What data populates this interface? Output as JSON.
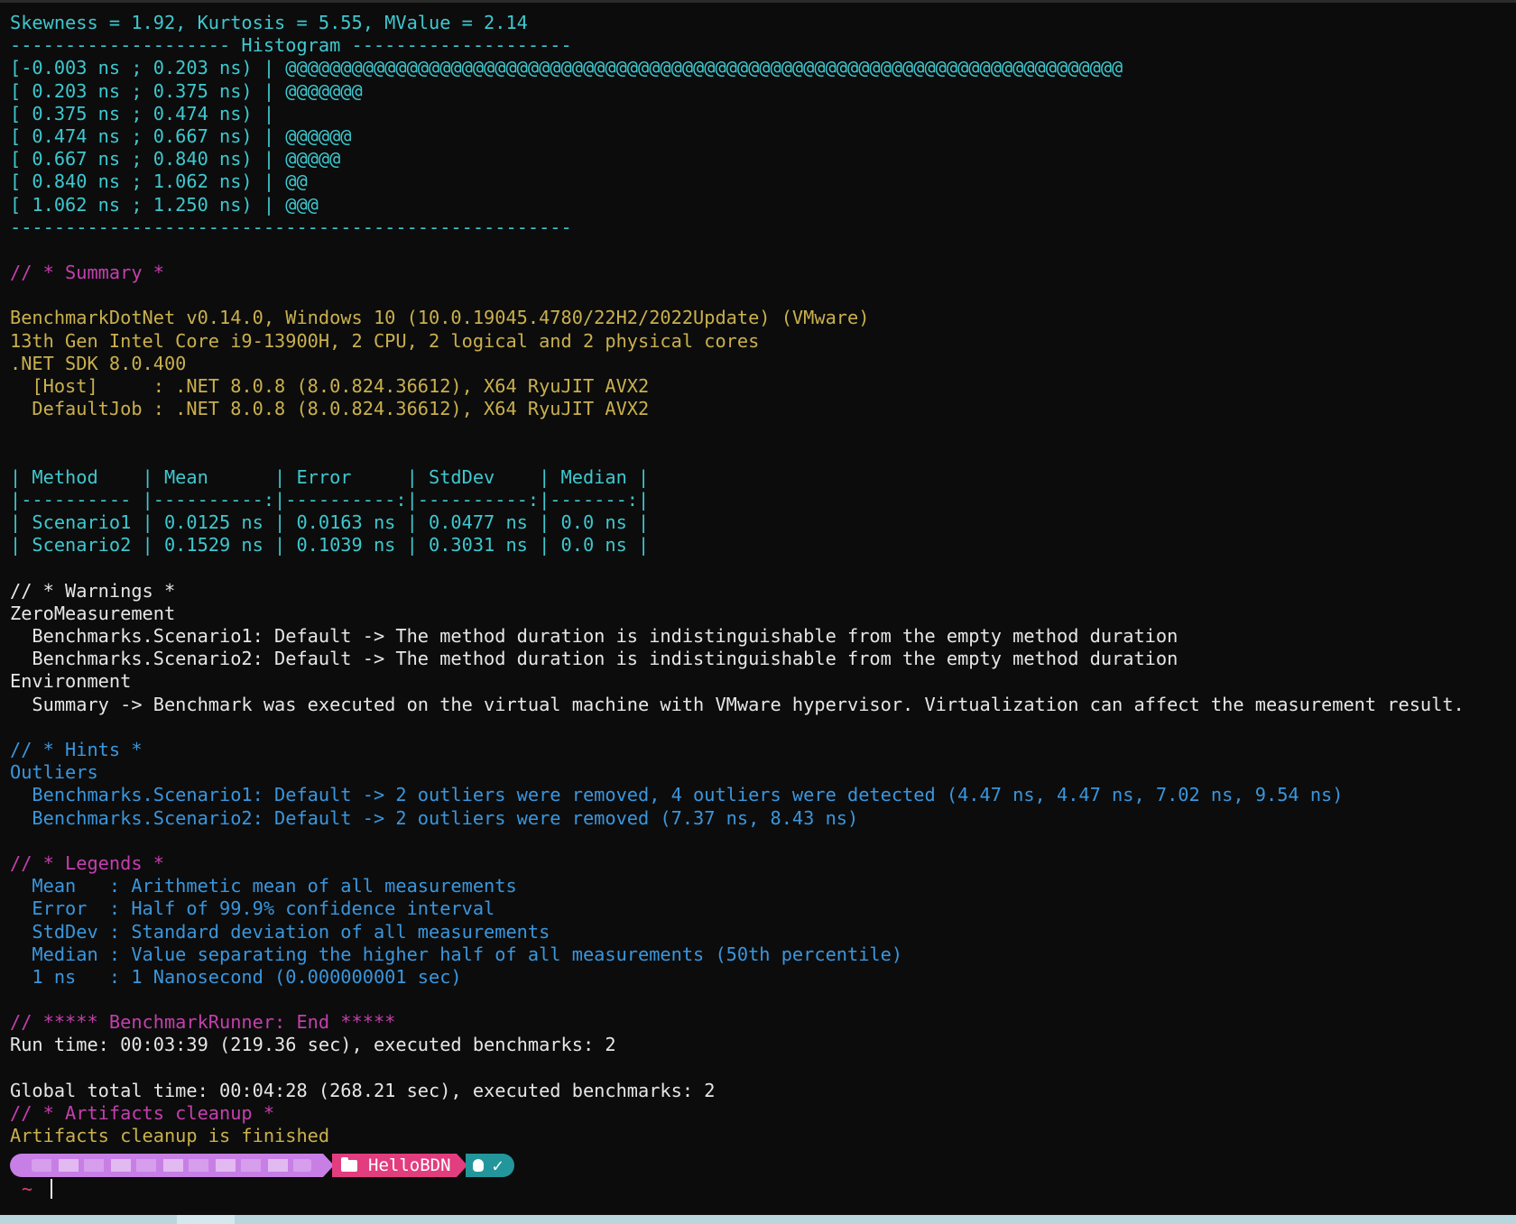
{
  "terminal": {
    "lines": [
      {
        "text": "Skewness = 1.92, Kurtosis = 5.55, MValue = 2.14",
        "color": "cyan"
      },
      {
        "text": "-------------------- Histogram --------------------",
        "color": "cyan"
      },
      {
        "text": "[-0.003 ns ; 0.203 ns) | @@@@@@@@@@@@@@@@@@@@@@@@@@@@@@@@@@@@@@@@@@@@@@@@@@@@@@@@@@@@@@@@@@@@@@@@@@@@",
        "color": "cyan"
      },
      {
        "text": "[ 0.203 ns ; 0.375 ns) | @@@@@@@",
        "color": "cyan"
      },
      {
        "text": "[ 0.375 ns ; 0.474 ns) |",
        "color": "cyan"
      },
      {
        "text": "[ 0.474 ns ; 0.667 ns) | @@@@@@",
        "color": "cyan"
      },
      {
        "text": "[ 0.667 ns ; 0.840 ns) | @@@@@",
        "color": "cyan"
      },
      {
        "text": "[ 0.840 ns ; 1.062 ns) | @@",
        "color": "cyan"
      },
      {
        "text": "[ 1.062 ns ; 1.250 ns) | @@@",
        "color": "cyan"
      },
      {
        "text": "---------------------------------------------------",
        "color": "cyan"
      },
      {
        "text": "",
        "color": "white"
      },
      {
        "text": "// * Summary *",
        "color": "magenta"
      },
      {
        "text": "",
        "color": "white"
      },
      {
        "text": "BenchmarkDotNet v0.14.0, Windows 10 (10.0.19045.4780/22H2/2022Update) (VMware)",
        "color": "yellow"
      },
      {
        "text": "13th Gen Intel Core i9-13900H, 2 CPU, 2 logical and 2 physical cores",
        "color": "yellow"
      },
      {
        "text": ".NET SDK 8.0.400",
        "color": "yellow"
      },
      {
        "text": "  [Host]     : .NET 8.0.8 (8.0.824.36612), X64 RyuJIT AVX2",
        "color": "yellow"
      },
      {
        "text": "  DefaultJob : .NET 8.0.8 (8.0.824.36612), X64 RyuJIT AVX2",
        "color": "yellow"
      },
      {
        "text": "",
        "color": "white"
      },
      {
        "text": "",
        "color": "white"
      },
      {
        "text": "| Method    | Mean      | Error     | StdDev    | Median |",
        "color": "cyan"
      },
      {
        "text": "|---------- |----------:|----------:|----------:|-------:|",
        "color": "cyan"
      },
      {
        "text": "| Scenario1 | 0.0125 ns | 0.0163 ns | 0.0477 ns | 0.0 ns |",
        "color": "cyan"
      },
      {
        "text": "| Scenario2 | 0.1529 ns | 0.1039 ns | 0.3031 ns | 0.0 ns |",
        "color": "cyan"
      },
      {
        "text": "",
        "color": "white"
      },
      {
        "text": "// * Warnings *",
        "color": "white"
      },
      {
        "text": "ZeroMeasurement",
        "color": "white"
      },
      {
        "text": "  Benchmarks.Scenario1: Default -> The method duration is indistinguishable from the empty method duration",
        "color": "white"
      },
      {
        "text": "  Benchmarks.Scenario2: Default -> The method duration is indistinguishable from the empty method duration",
        "color": "white"
      },
      {
        "text": "Environment",
        "color": "white"
      },
      {
        "text": "  Summary -> Benchmark was executed on the virtual machine with VMware hypervisor. Virtualization can affect the measurement result.",
        "color": "white"
      },
      {
        "text": "",
        "color": "white"
      },
      {
        "text": "// * Hints *",
        "color": "blue"
      },
      {
        "text": "Outliers",
        "color": "blue"
      },
      {
        "text": "  Benchmarks.Scenario1: Default -> 2 outliers were removed, 4 outliers were detected (4.47 ns, 4.47 ns, 7.02 ns, 9.54 ns)",
        "color": "blue"
      },
      {
        "text": "  Benchmarks.Scenario2: Default -> 2 outliers were removed (7.37 ns, 8.43 ns)",
        "color": "blue"
      },
      {
        "text": "",
        "color": "white"
      },
      {
        "text": "// * Legends *",
        "color": "magenta"
      },
      {
        "text": "  Mean   : Arithmetic mean of all measurements",
        "color": "blue"
      },
      {
        "text": "  Error  : Half of 99.9% confidence interval",
        "color": "blue"
      },
      {
        "text": "  StdDev : Standard deviation of all measurements",
        "color": "blue"
      },
      {
        "text": "  Median : Value separating the higher half of all measurements (50th percentile)",
        "color": "blue"
      },
      {
        "text": "  1 ns   : 1 Nanosecond (0.000000001 sec)",
        "color": "blue"
      },
      {
        "text": "",
        "color": "white"
      },
      {
        "text": "// ***** BenchmarkRunner: End *****",
        "color": "magenta"
      },
      {
        "text": "Run time: 00:03:39 (219.36 sec), executed benchmarks: 2",
        "color": "white"
      },
      {
        "text": "",
        "color": "white"
      },
      {
        "text": "Global total time: 00:04:28 (268.21 sec), executed benchmarks: 2",
        "color": "white"
      },
      {
        "text": "// * Artifacts cleanup *",
        "color": "magenta"
      },
      {
        "text": "Artifacts cleanup is finished",
        "color": "yellow"
      }
    ]
  },
  "prompt": {
    "directory": "HelloBDN",
    "tilde": "~",
    "check": "✓",
    "colors": {
      "user": "#c77fe6",
      "dir": "#e23d7f",
      "git": "#22969b"
    },
    "icons": [
      "folder-icon",
      "hand-icon",
      "check-icon"
    ]
  }
}
